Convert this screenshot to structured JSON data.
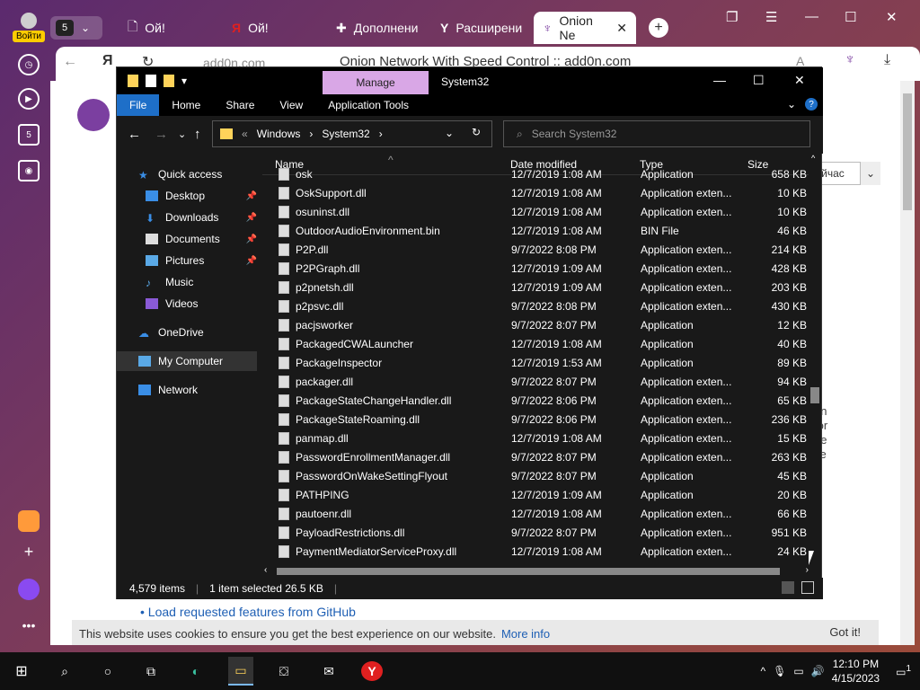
{
  "browser": {
    "profile_login": "Войти",
    "tab_count": "5",
    "tabs": [
      {
        "label": "Ой!",
        "icon": "document-icon"
      },
      {
        "label": "Ой!",
        "icon": "yandex-icon"
      },
      {
        "label": "Дополнени",
        "icon": "puzzle-icon"
      },
      {
        "label": "Расширени",
        "icon": "yandex-icon"
      },
      {
        "label": "Onion Ne",
        "icon": "onion-icon"
      }
    ],
    "address_domain": "add0n.com",
    "page_title": "Onion Network With Speed Control :: add0n.com",
    "sidebar_badge": "5",
    "page": {
      "link_text": "Load requested features from GitHub",
      "cookie_text": "This website uses cookies to ensure you get the best experience on our website.",
      "cookie_more": "More info",
      "cookie_got_it": "Got it!",
      "side_button": "йчас",
      "fragments": [
        "on",
        "for",
        "he",
        "ve"
      ]
    }
  },
  "explorer": {
    "title": "System32",
    "manage_tab": "Manage",
    "ribbon_tabs": [
      "File",
      "Home",
      "Share",
      "View",
      "Application Tools"
    ],
    "breadcrumb": [
      "«",
      "Windows",
      "System32"
    ],
    "search_placeholder": "Search System32",
    "nav": [
      {
        "label": "Quick access",
        "icon": "star-icon",
        "pinned": false
      },
      {
        "label": "Desktop",
        "icon": "desktop-icon",
        "pinned": true
      },
      {
        "label": "Downloads",
        "icon": "download-icon",
        "pinned": true
      },
      {
        "label": "Documents",
        "icon": "documents-icon",
        "pinned": true
      },
      {
        "label": "Pictures",
        "icon": "pictures-icon",
        "pinned": true
      },
      {
        "label": "Music",
        "icon": "music-icon",
        "pinned": false
      },
      {
        "label": "Videos",
        "icon": "videos-icon",
        "pinned": false
      },
      {
        "label": "OneDrive",
        "icon": "cloud-icon",
        "pinned": false
      },
      {
        "label": "My Computer",
        "icon": "computer-icon",
        "pinned": false
      },
      {
        "label": "Network",
        "icon": "network-icon",
        "pinned": false
      }
    ],
    "columns": [
      "Name",
      "Date modified",
      "Type",
      "Size"
    ],
    "files": [
      {
        "name": "osk",
        "date": "12/7/2019 1:08 AM",
        "type": "Application",
        "size": "658 KB"
      },
      {
        "name": "OskSupport.dll",
        "date": "12/7/2019 1:08 AM",
        "type": "Application exten...",
        "size": "10 KB"
      },
      {
        "name": "osuninst.dll",
        "date": "12/7/2019 1:08 AM",
        "type": "Application exten...",
        "size": "10 KB"
      },
      {
        "name": "OutdoorAudioEnvironment.bin",
        "date": "12/7/2019 1:08 AM",
        "type": "BIN File",
        "size": "46 KB"
      },
      {
        "name": "P2P.dll",
        "date": "9/7/2022 8:08 PM",
        "type": "Application exten...",
        "size": "214 KB"
      },
      {
        "name": "P2PGraph.dll",
        "date": "12/7/2019 1:09 AM",
        "type": "Application exten...",
        "size": "428 KB"
      },
      {
        "name": "p2pnetsh.dll",
        "date": "12/7/2019 1:09 AM",
        "type": "Application exten...",
        "size": "203 KB"
      },
      {
        "name": "p2psvc.dll",
        "date": "9/7/2022 8:08 PM",
        "type": "Application exten...",
        "size": "430 KB"
      },
      {
        "name": "pacjsworker",
        "date": "9/7/2022 8:07 PM",
        "type": "Application",
        "size": "12 KB"
      },
      {
        "name": "PackagedCWALauncher",
        "date": "12/7/2019 1:08 AM",
        "type": "Application",
        "size": "40 KB"
      },
      {
        "name": "PackageInspector",
        "date": "12/7/2019 1:53 AM",
        "type": "Application",
        "size": "89 KB"
      },
      {
        "name": "packager.dll",
        "date": "9/7/2022 8:07 PM",
        "type": "Application exten...",
        "size": "94 KB"
      },
      {
        "name": "PackageStateChangeHandler.dll",
        "date": "9/7/2022 8:06 PM",
        "type": "Application exten...",
        "size": "65 KB"
      },
      {
        "name": "PackageStateRoaming.dll",
        "date": "9/7/2022 8:06 PM",
        "type": "Application exten...",
        "size": "236 KB"
      },
      {
        "name": "panmap.dll",
        "date": "12/7/2019 1:08 AM",
        "type": "Application exten...",
        "size": "15 KB"
      },
      {
        "name": "PasswordEnrollmentManager.dll",
        "date": "9/7/2022 8:07 PM",
        "type": "Application exten...",
        "size": "263 KB"
      },
      {
        "name": "PasswordOnWakeSettingFlyout",
        "date": "9/7/2022 8:07 PM",
        "type": "Application",
        "size": "45 KB"
      },
      {
        "name": "PATHPING",
        "date": "12/7/2019 1:09 AM",
        "type": "Application",
        "size": "20 KB"
      },
      {
        "name": "pautoenr.dll",
        "date": "12/7/2019 1:08 AM",
        "type": "Application exten...",
        "size": "66 KB"
      },
      {
        "name": "PayloadRestrictions.dll",
        "date": "9/7/2022 8:07 PM",
        "type": "Application exten...",
        "size": "951 KB"
      },
      {
        "name": "PaymentMediatorServiceProxy.dll",
        "date": "12/7/2019 1:08 AM",
        "type": "Application exten...",
        "size": "24 KB"
      }
    ],
    "status": {
      "items": "4,579 items",
      "selected": "1 item selected  26.5 KB"
    }
  },
  "taskbar": {
    "time": "12:10 PM",
    "date": "4/15/2023",
    "notification_count": "1"
  },
  "colors": {
    "accent": "#1e6fc8",
    "manage": "#d9a7e6",
    "folder": "#ffd35a",
    "yandex_red": "#e02020"
  }
}
